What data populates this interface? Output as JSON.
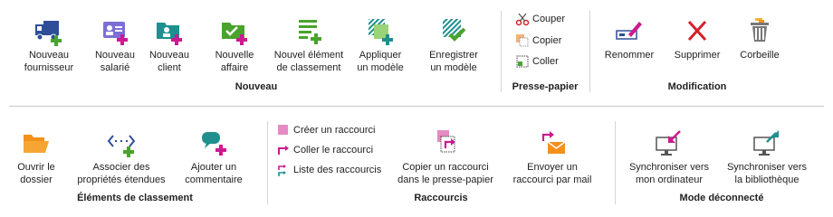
{
  "colors": {
    "magenta": "#cc1a8f",
    "green": "#49a32c",
    "teal": "#1f8f8f",
    "blue": "#2f4e98",
    "orange": "#f3911b",
    "red": "#d4212a",
    "separator": "#c9c9c9"
  },
  "nouveau": {
    "group_label": "Nouveau",
    "buttons": [
      {
        "l1": "Nouveau",
        "l2": "fournisseur",
        "icon": "truck-add-icon"
      },
      {
        "l1": "Nouveau",
        "l2": "salarié",
        "icon": "id-card-add-icon"
      },
      {
        "l1": "Nouveau",
        "l2": "client",
        "icon": "folder-person-add-icon"
      },
      {
        "l1": "Nouvelle",
        "l2": "affaire",
        "icon": "folder-check-add-icon"
      },
      {
        "l1": "Nouvel élément",
        "l2": "de classement",
        "icon": "list-add-icon"
      },
      {
        "l1": "Appliquer",
        "l2": "un modèle",
        "icon": "template-apply-icon"
      },
      {
        "l1": "Enregistrer",
        "l2": "un modèle",
        "icon": "template-save-icon"
      }
    ]
  },
  "presse_papier": {
    "group_label": "Presse-papier",
    "items": [
      {
        "label": "Couper",
        "icon": "scissors-icon"
      },
      {
        "label": "Copier",
        "icon": "copy-icon"
      },
      {
        "label": "Coller",
        "icon": "paste-icon"
      }
    ]
  },
  "modification": {
    "group_label": "Modification",
    "buttons": [
      {
        "label": "Renommer",
        "icon": "rename-icon"
      },
      {
        "label": "Supprimer",
        "icon": "delete-x-icon"
      },
      {
        "label": "Corbeille",
        "icon": "trash-icon"
      }
    ]
  },
  "elements_classement": {
    "group_label": "Éléments de classement",
    "buttons": [
      {
        "l1": "Ouvrir le",
        "l2": "dossier",
        "icon": "open-folder-icon"
      },
      {
        "l1": "Associer des",
        "l2": "propriétés étendues",
        "icon": "properties-add-icon"
      },
      {
        "l1": "Ajouter un",
        "l2": "commentaire",
        "icon": "comment-add-icon"
      }
    ]
  },
  "raccourcis": {
    "group_label": "Raccourcis",
    "items": [
      {
        "label": "Créer un raccourci",
        "icon": "shortcut-create-icon"
      },
      {
        "label": "Coller le raccourci",
        "icon": "shortcut-paste-icon"
      },
      {
        "label": "Liste des raccourcis",
        "icon": "shortcut-list-icon"
      }
    ],
    "buttons": [
      {
        "l1": "Copier un raccourci",
        "l2": "dans le presse-papier",
        "icon": "shortcut-copy-clipboard-icon"
      },
      {
        "l1": "Envoyer un",
        "l2": "raccourci par mail",
        "icon": "shortcut-mail-icon"
      }
    ]
  },
  "mode_deconnecte": {
    "group_label": "Mode déconnecté",
    "buttons": [
      {
        "l1": "Synchroniser vers",
        "l2": "mon ordinateur",
        "icon": "sync-to-computer-icon"
      },
      {
        "l1": "Synchroniser vers",
        "l2": "la bibliothèque",
        "icon": "sync-to-library-icon"
      }
    ]
  }
}
